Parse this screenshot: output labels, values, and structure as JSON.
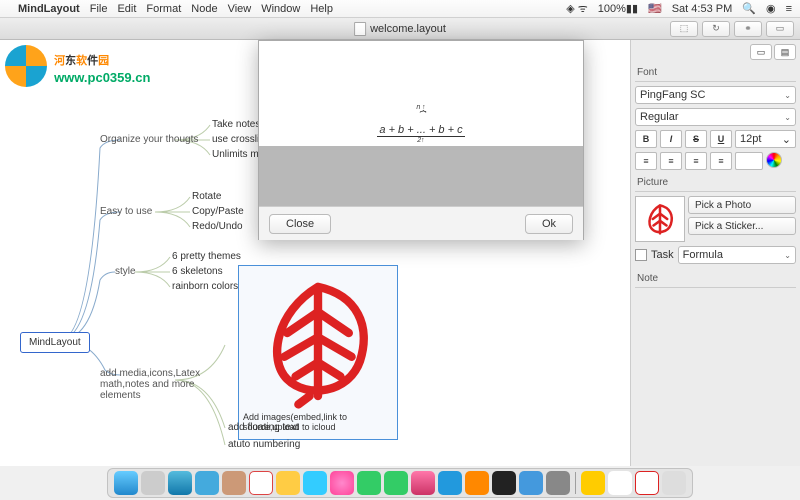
{
  "menubar": {
    "app": "MindLayout",
    "items": [
      "File",
      "Edit",
      "Format",
      "Node",
      "View",
      "Window",
      "Help"
    ],
    "wifi": "⏚",
    "battery": "100%",
    "flag": "🇺🇸",
    "time": "Sat 4:53 PM"
  },
  "window": {
    "title": "welcome.layout"
  },
  "watermark": {
    "chars": [
      "河",
      "东",
      "软",
      "件",
      "园"
    ],
    "url": "www.pc0359.cn"
  },
  "mindmap": {
    "root": "MindLayout",
    "groups": [
      {
        "label": "Organize your thougts",
        "children": [
          "Take notes",
          "use crosslinks",
          "Unlimits map s"
        ]
      },
      {
        "label": "Easy to use",
        "children": [
          "Rotate",
          "Copy/Paste",
          "Redo/Undo"
        ]
      },
      {
        "label": "style",
        "children": [
          "6 pretty themes",
          "6 skeletons",
          "rainborn colors"
        ]
      },
      {
        "label": "add media,icons,Latex math,notes and more elements",
        "children": [
          "Add images(embed,link to source,upload to icloud",
          "add floating text",
          "atuto numbering"
        ]
      }
    ]
  },
  "modal": {
    "formula_num": "a + b + ... + b + c",
    "formula_top": "n ↑",
    "formula_bot": "2↑",
    "close": "Close",
    "ok": "Ok"
  },
  "inspector": {
    "font": {
      "heading": "Font",
      "family": "PingFang SC",
      "style": "Regular",
      "size": "12pt"
    },
    "styles": {
      "bold": "B",
      "italic": "I",
      "strike": "S",
      "underline": "U"
    },
    "picture": {
      "heading": "Picture",
      "pick_photo": "Pick a Photo",
      "pick_sticker": "Pick a Sticker..."
    },
    "task": {
      "label": "Task",
      "formula": "Formula"
    },
    "note": {
      "heading": "Note"
    }
  },
  "dock": {
    "items": [
      "finder",
      "launchpad",
      "safari",
      "mail",
      "contacts",
      "calendar",
      "notes",
      "reminders",
      "maps",
      "photos",
      "messages",
      "facetime",
      "itunes",
      "appstore",
      "ibooks",
      "terminal",
      "preview",
      "settings",
      "qq",
      "mindlayout",
      "trash"
    ]
  }
}
